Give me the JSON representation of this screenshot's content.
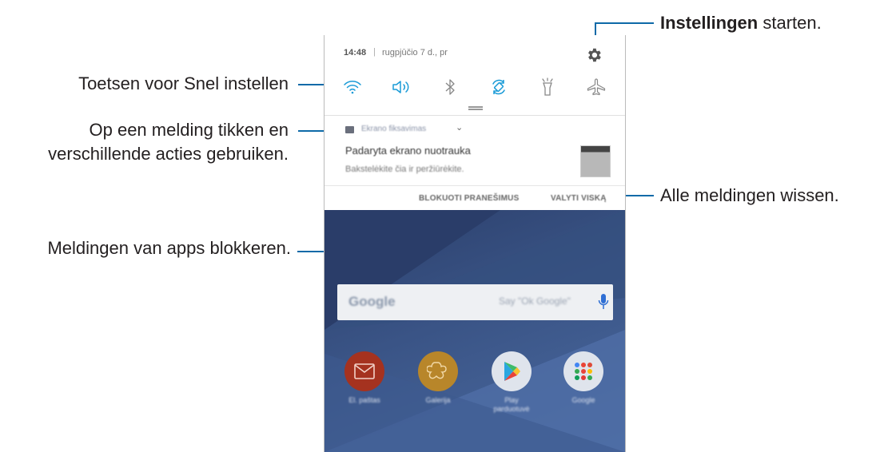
{
  "callouts": {
    "settings_bold": "Instellingen",
    "settings_rest": " starten.",
    "quick_settings": "Toetsen voor Snel instellen",
    "notification_line1": "Op een melding tikken en",
    "notification_line2": "verschillende acties gebruiken.",
    "clear_all": "Alle meldingen wissen.",
    "block_apps": "Meldingen van apps blokkeren."
  },
  "phone": {
    "status": {
      "time": "14:48",
      "separator": "|",
      "date": "rugpjūčio 7 d., pr"
    },
    "quick_settings": [
      {
        "name": "wifi-icon",
        "state": "on"
      },
      {
        "name": "sound-icon",
        "state": "on"
      },
      {
        "name": "bluetooth-icon",
        "state": "off"
      },
      {
        "name": "auto-rotate-icon",
        "state": "on"
      },
      {
        "name": "flashlight-icon",
        "state": "off"
      },
      {
        "name": "airplane-mode-icon",
        "state": "off"
      }
    ],
    "notification": {
      "app_name": "Ekrano fiksavimas",
      "title": "Padaryta ekrano nuotrauka",
      "body": "Bakstelėkite čia ir peržiūrėkite."
    },
    "actions": {
      "block": "BLOKUOTI PRANEŠIMUS",
      "clear": "VALYTI VISKĄ"
    },
    "search": {
      "logo": "Google",
      "hint": "Say \"Ok Google\""
    },
    "apps": [
      {
        "label": "El. paštas",
        "color": "#a5321f"
      },
      {
        "label": "Galerija",
        "color": "#b8862a"
      },
      {
        "label": "Play parduotuvė",
        "color": "#dfe4ec"
      },
      {
        "label": "Google",
        "color": "#dfe4ec"
      }
    ],
    "colors": {
      "accent": "#1a9bd7",
      "callout_line": "#0e6aa8"
    }
  }
}
